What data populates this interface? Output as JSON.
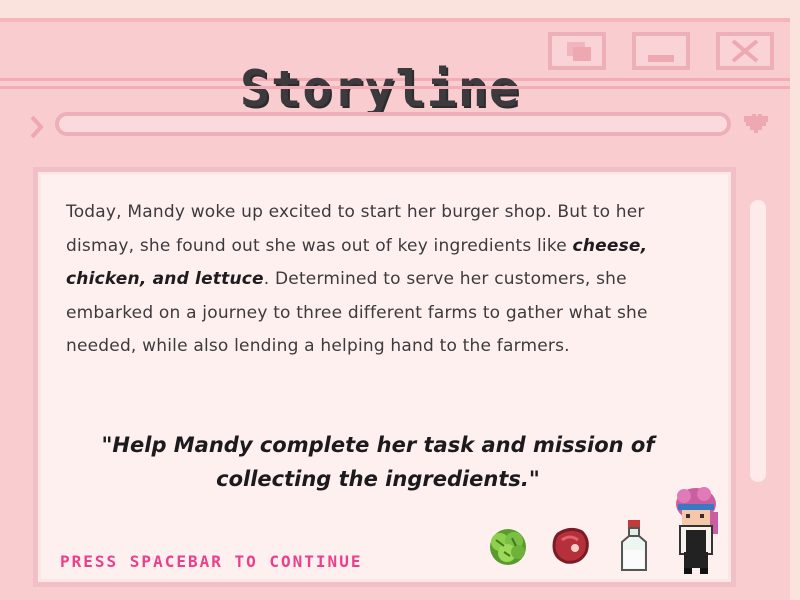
{
  "window": {
    "title": "Storyline",
    "controls": [
      "restore",
      "minimize",
      "close"
    ]
  },
  "story": {
    "intro": "Today, Mandy woke up excited to start her burger shop. But to her dismay, she found out she was out of key ingredients like ",
    "highlight": "cheese, chicken, and lettuce",
    "outro": ". Determined to serve her customers, she embarked on a journey to three different farms to gather what she needed, while also lending a helping hand to the farmers.",
    "quote": "\"Help Mandy complete her task and mission of collecting the ingredients.\""
  },
  "prompt": "PRESS SPACEBAR TO CONTINUE",
  "items": [
    "lettuce",
    "meat",
    "milk"
  ],
  "character": "Mandy",
  "colors": {
    "background": "#fbe3dd",
    "window": "#f9cdd0",
    "panel": "#fdf0ee",
    "accent": "#ec3f8b",
    "text": "#3d3a3d"
  }
}
